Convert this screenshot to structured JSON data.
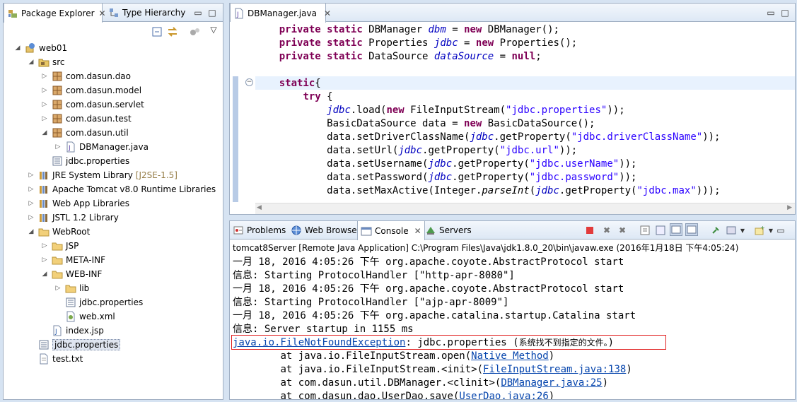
{
  "explorer": {
    "tabs": [
      {
        "label": "Package Explorer",
        "icon": "package-explorer-icon"
      },
      {
        "label": "Type Hierarchy",
        "icon": "type-hierarchy-icon"
      }
    ],
    "tree": [
      {
        "label": "web01",
        "icon": "web-project-icon",
        "depth": 0,
        "arrow": "expanded"
      },
      {
        "label": "src",
        "icon": "source-folder-icon",
        "depth": 1,
        "arrow": "expanded"
      },
      {
        "label": "com.dasun.dao",
        "icon": "package-icon",
        "depth": 2,
        "arrow": "collapsed"
      },
      {
        "label": "com.dasun.model",
        "icon": "package-icon",
        "depth": 2,
        "arrow": "collapsed"
      },
      {
        "label": "com.dasun.servlet",
        "icon": "package-icon",
        "depth": 2,
        "arrow": "collapsed"
      },
      {
        "label": "com.dasun.test",
        "icon": "package-icon",
        "depth": 2,
        "arrow": "collapsed"
      },
      {
        "label": "com.dasun.util",
        "icon": "package-icon",
        "depth": 2,
        "arrow": "expanded"
      },
      {
        "label": "DBManager.java",
        "icon": "java-file-icon",
        "depth": 3,
        "arrow": "collapsed"
      },
      {
        "label": "jdbc.properties",
        "icon": "properties-file-icon",
        "depth": 2,
        "arrow": "none"
      },
      {
        "label": "JRE System Library",
        "decoration": "[J2SE-1.5]",
        "icon": "library-icon",
        "depth": 1,
        "arrow": "collapsed"
      },
      {
        "label": "Apache Tomcat v8.0 Runtime Libraries",
        "icon": "library-icon",
        "depth": 1,
        "arrow": "collapsed"
      },
      {
        "label": "Web App Libraries",
        "icon": "library-icon",
        "depth": 1,
        "arrow": "collapsed"
      },
      {
        "label": "JSTL 1.2 Library",
        "icon": "library-icon",
        "depth": 1,
        "arrow": "collapsed"
      },
      {
        "label": "WebRoot",
        "icon": "folder-icon",
        "depth": 1,
        "arrow": "expanded"
      },
      {
        "label": "JSP",
        "icon": "folder-icon",
        "depth": 2,
        "arrow": "collapsed"
      },
      {
        "label": "META-INF",
        "icon": "folder-icon",
        "depth": 2,
        "arrow": "collapsed"
      },
      {
        "label": "WEB-INF",
        "icon": "folder-icon",
        "depth": 2,
        "arrow": "expanded"
      },
      {
        "label": "lib",
        "icon": "folder-icon",
        "depth": 3,
        "arrow": "collapsed"
      },
      {
        "label": "jdbc.properties",
        "icon": "properties-file-icon",
        "depth": 3,
        "arrow": "none"
      },
      {
        "label": "web.xml",
        "icon": "xml-file-icon",
        "depth": 3,
        "arrow": "none"
      },
      {
        "label": "index.jsp",
        "icon": "jsp-file-icon",
        "depth": 2,
        "arrow": "none"
      },
      {
        "label": "jdbc.properties",
        "icon": "properties-file-icon",
        "depth": 1,
        "arrow": "none",
        "selected": true
      },
      {
        "label": "test.txt",
        "icon": "text-file-icon",
        "depth": 1,
        "arrow": "none"
      }
    ]
  },
  "editor": {
    "tab_label": "DBManager.java",
    "lines": [
      {
        "indent": 4,
        "tokens": [
          [
            "kw",
            "private"
          ],
          [
            "",
            " "
          ],
          [
            "kw",
            "static"
          ],
          [
            "",
            " DBManager "
          ],
          [
            "fld",
            "dbm"
          ],
          [
            "",
            " = "
          ],
          [
            "kw",
            "new"
          ],
          [
            "",
            " DBManager();"
          ]
        ]
      },
      {
        "indent": 4,
        "tokens": [
          [
            "kw",
            "private"
          ],
          [
            "",
            " "
          ],
          [
            "kw",
            "static"
          ],
          [
            "",
            " Properties "
          ],
          [
            "fld",
            "jdbc"
          ],
          [
            "",
            " = "
          ],
          [
            "kw",
            "new"
          ],
          [
            "",
            " Properties();"
          ]
        ]
      },
      {
        "indent": 4,
        "tokens": [
          [
            "kw",
            "private"
          ],
          [
            "",
            " "
          ],
          [
            "kw",
            "static"
          ],
          [
            "",
            " DataSource "
          ],
          [
            "fld",
            "dataSource"
          ],
          [
            "",
            " = "
          ],
          [
            "kw",
            "null"
          ],
          [
            "",
            ";"
          ]
        ]
      },
      {
        "indent": 0,
        "tokens": []
      },
      {
        "indent": 4,
        "tokens": [
          [
            "kw",
            "static"
          ],
          [
            "",
            "{"
          ]
        ],
        "highlight": true
      },
      {
        "indent": 8,
        "tokens": [
          [
            "kw",
            "try"
          ],
          [
            "",
            " {"
          ]
        ]
      },
      {
        "indent": 12,
        "tokens": [
          [
            "fld",
            "jdbc"
          ],
          [
            "",
            ".load("
          ],
          [
            "kw",
            "new"
          ],
          [
            "",
            " FileInputStream("
          ],
          [
            "str",
            "\"jdbc.properties\""
          ],
          [
            "",
            "));"
          ]
        ]
      },
      {
        "indent": 12,
        "tokens": [
          [
            "",
            "BasicDataSource data = "
          ],
          [
            "kw",
            "new"
          ],
          [
            "",
            " BasicDataSource();"
          ]
        ]
      },
      {
        "indent": 12,
        "tokens": [
          [
            "",
            "data.setDriverClassName("
          ],
          [
            "fld",
            "jdbc"
          ],
          [
            "",
            ".getProperty("
          ],
          [
            "str",
            "\"jdbc.driverClassName\""
          ],
          [
            "",
            "));"
          ]
        ]
      },
      {
        "indent": 12,
        "tokens": [
          [
            "",
            "data.setUrl("
          ],
          [
            "fld",
            "jdbc"
          ],
          [
            "",
            ".getProperty("
          ],
          [
            "str",
            "\"jdbc.url\""
          ],
          [
            "",
            "));"
          ]
        ]
      },
      {
        "indent": 12,
        "tokens": [
          [
            "",
            "data.setUsername("
          ],
          [
            "fld",
            "jdbc"
          ],
          [
            "",
            ".getProperty("
          ],
          [
            "str",
            "\"jdbc.userName\""
          ],
          [
            "",
            "));"
          ]
        ]
      },
      {
        "indent": 12,
        "tokens": [
          [
            "",
            "data.setPassword("
          ],
          [
            "fld",
            "jdbc"
          ],
          [
            "",
            ".getProperty("
          ],
          [
            "str",
            "\"jdbc.password\""
          ],
          [
            "",
            "));"
          ]
        ]
      },
      {
        "indent": 12,
        "tokens": [
          [
            "",
            "data.setMaxActive(Integer."
          ],
          [
            "it",
            "parseInt"
          ],
          [
            "",
            "("
          ],
          [
            "fld",
            "jdbc"
          ],
          [
            "",
            ".getProperty("
          ],
          [
            "str",
            "\"jdbc.max\""
          ],
          [
            "",
            ")));"
          ]
        ]
      }
    ]
  },
  "console_view": {
    "tabs": [
      {
        "label": "Problems",
        "icon": "problems-icon"
      },
      {
        "label": "Web Browser",
        "icon": "web-browser-icon"
      },
      {
        "label": "Console",
        "icon": "console-icon",
        "active": true
      },
      {
        "label": "Servers",
        "icon": "servers-icon"
      }
    ],
    "process_label": "tomcat8Server [Remote Java Application] C:\\Program Files\\Java\\jdk1.8.0_20\\bin\\javaw.exe (2016年1月18日 下午4:05:24)",
    "lines": [
      [
        [
          "",
          "一月 18, 2016 4:05:26 下午 org.apache.coyote.AbstractProtocol start"
        ]
      ],
      [
        [
          "",
          "信息: Starting ProtocolHandler [\"http-apr-8080\"]"
        ]
      ],
      [
        [
          "",
          "一月 18, 2016 4:05:26 下午 org.apache.coyote.AbstractProtocol start"
        ]
      ],
      [
        [
          "",
          "信息: Starting ProtocolHandler [\"ajp-apr-8009\"]"
        ]
      ],
      [
        [
          "",
          "一月 18, 2016 4:05:26 下午 org.apache.catalina.startup.Catalina start"
        ]
      ],
      [
        [
          "",
          "信息: Server startup in 1155 ms"
        ]
      ],
      [
        [
          "lnk",
          "java.io.FileNotFoundException"
        ],
        [
          "",
          ": jdbc.properties ("
        ],
        [
          "cjk",
          "系统找不到指定的文件。"
        ],
        [
          "",
          ")"
        ]
      ],
      [
        [
          "",
          "\tat java.io.FileInputStream.open("
        ],
        [
          "lnk",
          "Native Method"
        ],
        [
          "",
          ")"
        ]
      ],
      [
        [
          "",
          "\tat java.io.FileInputStream.<init>("
        ],
        [
          "lnk",
          "FileInputStream.java:138"
        ],
        [
          "",
          ")"
        ]
      ],
      [
        [
          "",
          "\tat com.dasun.util.DBManager.<clinit>("
        ],
        [
          "lnk",
          "DBManager.java:25"
        ],
        [
          "",
          ")"
        ]
      ],
      [
        [
          "",
          "\tat com.dasun.dao.UserDao.save("
        ],
        [
          "lnk",
          "UserDao.java:26"
        ],
        [
          "",
          ")"
        ]
      ]
    ],
    "error_highlight_color": "#e02020"
  },
  "colors": {
    "keyword": "#7f0055",
    "field": "#0000c0",
    "string": "#2a00ff",
    "link": "#0645ad"
  }
}
